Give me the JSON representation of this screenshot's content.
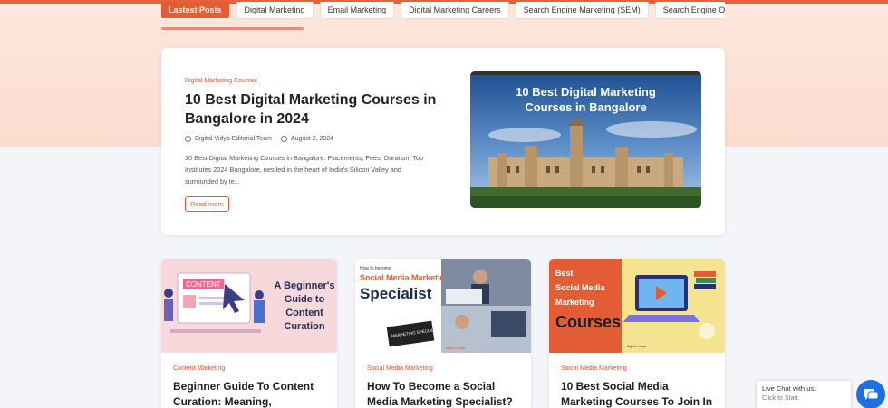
{
  "tabs": [
    {
      "label": "Lastest Posts",
      "active": true
    },
    {
      "label": "Digital Marketing"
    },
    {
      "label": "Email Marketing"
    },
    {
      "label": "Digital Marketing Careers"
    },
    {
      "label": "Search Engine Marketing (SEM)"
    },
    {
      "label": "Search Engine Optim"
    }
  ],
  "featured": {
    "category": "Digital Marketing Courses",
    "title": "10 Best Digital Marketing Courses in Bangalore in 2024",
    "author": "Digital Vidya Editorial Team",
    "date": "August 2, 2024",
    "excerpt": "10 Best Digital Marketing Courses in Bangalore: Placements, Fees, Duration, Top Institutes 2024 Bangalore, nestled in the heart of India's Silicon Valley and surrounded by te...",
    "read_more": "Read more",
    "image_text": "10 Best Digital Marketing Courses in Bangalore"
  },
  "cards": [
    {
      "category": "Content Marketing",
      "title": "Beginner Guide To Content Curation: Meaning,",
      "image_text": "A Beginner's Guide to Content Curation",
      "image_badge": "CONTENT"
    },
    {
      "category": "Social Media Marketing",
      "title": "How To Become a Social Media Marketing Specialist?",
      "image_kicker": "How to become",
      "image_line1": "Social Media Marketing",
      "image_line2": "Specialist",
      "image_tag": "MARKETING SPECIALIST",
      "image_logo": "digital vidya"
    },
    {
      "category": "Social Media Marketing",
      "title": "10 Best Social Media Marketing Courses To Join In",
      "image_line1": "Best",
      "image_line2": "Social Media",
      "image_line3": "Marketing",
      "image_line4": "Courses",
      "image_logo": "digital vidya"
    }
  ],
  "chat": {
    "line1": "Live Chat with us.",
    "line2": "Click to Start."
  },
  "colors": {
    "accent": "#e25d36",
    "band": "#fde7dd",
    "chat": "#1e6fe0"
  }
}
